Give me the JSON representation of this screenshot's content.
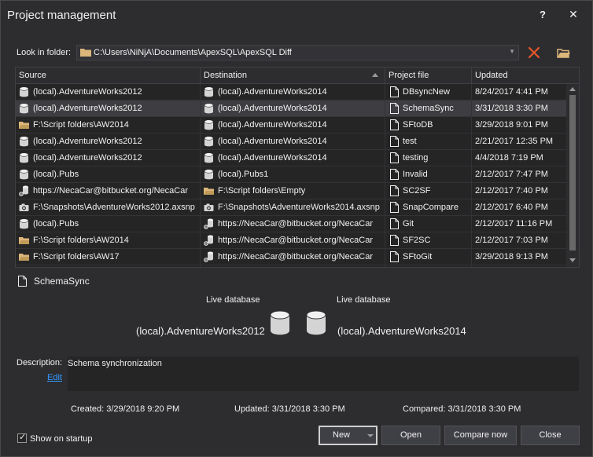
{
  "window": {
    "title": "Project management",
    "help_label": "?",
    "close_label": "✕"
  },
  "folder": {
    "label": "Look in folder:",
    "path": "C:\\Users\\NiNjA\\Documents\\ApexSQL\\ApexSQL Diff"
  },
  "grid": {
    "headers": {
      "source": "Source",
      "destination": "Destination",
      "project_file": "Project file",
      "updated": "Updated"
    },
    "rows": [
      {
        "source_icon": "database-icon",
        "source": "(local).AdventureWorks2012",
        "dest_icon": "database-icon",
        "destination": "(local).AdventureWorks2014",
        "project_file": "DBsyncNew",
        "updated": "8/24/2017 4:41 PM"
      },
      {
        "source_icon": "database-icon",
        "source": "(local).AdventureWorks2012",
        "dest_icon": "database-icon",
        "destination": "(local).AdventureWorks2014",
        "project_file": "SchemaSync",
        "updated": "3/31/2018 3:30 PM"
      },
      {
        "source_icon": "folder-icon",
        "source": "F:\\Script folders\\AW2014",
        "dest_icon": "database-icon",
        "destination": "(local).AdventureWorks2014",
        "project_file": "SFtoDB",
        "updated": "3/29/2018 9:01 PM"
      },
      {
        "source_icon": "database-icon",
        "source": "(local).AdventureWorks2012",
        "dest_icon": "database-icon",
        "destination": "(local).AdventureWorks2014",
        "project_file": "test",
        "updated": "2/21/2017 12:35 PM"
      },
      {
        "source_icon": "database-icon",
        "source": "(local).AdventureWorks2012",
        "dest_icon": "database-icon",
        "destination": "(local).AdventureWorks2014",
        "project_file": "testing",
        "updated": "4/4/2018 7:19 PM"
      },
      {
        "source_icon": "database-icon",
        "source": "(local).Pubs",
        "dest_icon": "database-icon",
        "destination": "(local).Pubs1",
        "project_file": "Invalid",
        "updated": "2/12/2017 7:47 PM"
      },
      {
        "source_icon": "source-control-icon",
        "source": "https://NecaCar@bitbucket.org/NecaCar",
        "dest_icon": "folder-icon",
        "destination": "F:\\Script folders\\Empty",
        "project_file": "SC2SF",
        "updated": "2/12/2017 7:40 PM"
      },
      {
        "source_icon": "snapshot-icon",
        "source": "F:\\Snapshots\\AdventureWorks2012.axsnp",
        "dest_icon": "snapshot-icon",
        "destination": "F:\\Snapshots\\AdventureWorks2014.axsnp",
        "project_file": "SnapCompare",
        "updated": "2/12/2017 6:40 PM"
      },
      {
        "source_icon": "database-icon",
        "source": "(local).Pubs",
        "dest_icon": "source-control-icon",
        "destination": "https://NecaCar@bitbucket.org/NecaCar",
        "project_file": "Git",
        "updated": "2/12/2017 11:16 PM"
      },
      {
        "source_icon": "folder-icon",
        "source": "F:\\Script folders\\AW2014",
        "dest_icon": "source-control-icon",
        "destination": "https://NecaCar@bitbucket.org/NecaCar",
        "project_file": "SF2SC",
        "updated": "2/12/2017 7:03 PM"
      },
      {
        "source_icon": "folder-icon",
        "source": "F:\\Script folders\\AW17",
        "dest_icon": "source-control-icon",
        "destination": "https://NecaCar@bitbucket.org/NecaCar",
        "project_file": "SFtoGit",
        "updated": "3/29/2018 9:13 PM"
      }
    ],
    "selected_index": 1
  },
  "details": {
    "project_name": "SchemaSync",
    "source_type": "Live database",
    "source_name": "(local).AdventureWorks2012",
    "dest_type": "Live database",
    "dest_name": "(local).AdventureWorks2014",
    "description_label": "Description:",
    "description": "Schema synchronization",
    "edit_label": "Edit",
    "created": "Created: 3/29/2018 9:20 PM",
    "updated": "Updated: 3/31/2018 3:30 PM",
    "compared": "Compared: 3/31/2018 3:30 PM"
  },
  "footer": {
    "show_on_startup_label": "Show on startup",
    "show_on_startup_checked": true,
    "check_mark": "✓",
    "new_label": "New",
    "open_label": "Open",
    "compare_now_label": "Compare now",
    "close_label": "Close"
  },
  "colors": {
    "background": "#2d2d30",
    "grid": "#252526",
    "selected_row": "#3e3e42",
    "link": "#3399ff",
    "clear_icon": "#e8562a",
    "folder_icon": "#dcb67a"
  }
}
